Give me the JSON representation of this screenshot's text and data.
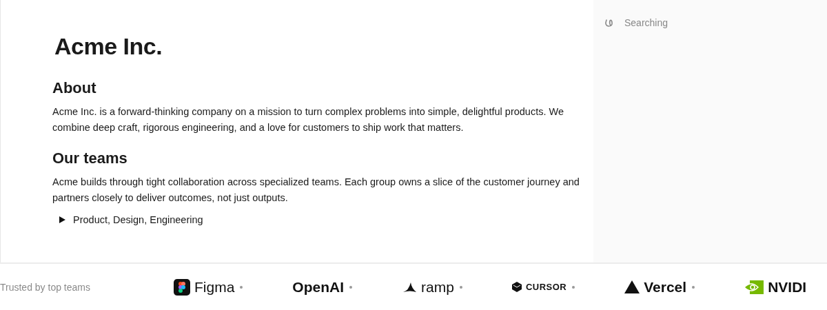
{
  "document": {
    "title": "Acme Inc.",
    "sections": [
      {
        "heading": "About",
        "body": "Acme Inc. is a forward-thinking company on a mission to turn complex problems into simple, delightful products. We combine deep craft, rigorous engineering, and a love for customers to ship work that matters."
      },
      {
        "heading": "Our teams",
        "body": "Acme builds through tight collaboration across specialized teams. Each group owns a slice of the customer journey and partners closely to deliver outcomes, not just outputs.",
        "disclosure": {
          "label": "Product, Design, Engineering",
          "expanded": false
        }
      }
    ]
  },
  "side_panel": {
    "status": "Searching"
  },
  "logo_strip": {
    "label": "Trusted by top teams",
    "logos": [
      {
        "kind": "figma",
        "name": "Figma"
      },
      {
        "kind": "openai",
        "name": "OpenAI"
      },
      {
        "kind": "ramp",
        "name": "ramp"
      },
      {
        "kind": "cursor",
        "name": "CURSOR"
      },
      {
        "kind": "vercel",
        "name": "Vercel"
      },
      {
        "kind": "nvidia",
        "name": "NVIDI"
      }
    ]
  }
}
